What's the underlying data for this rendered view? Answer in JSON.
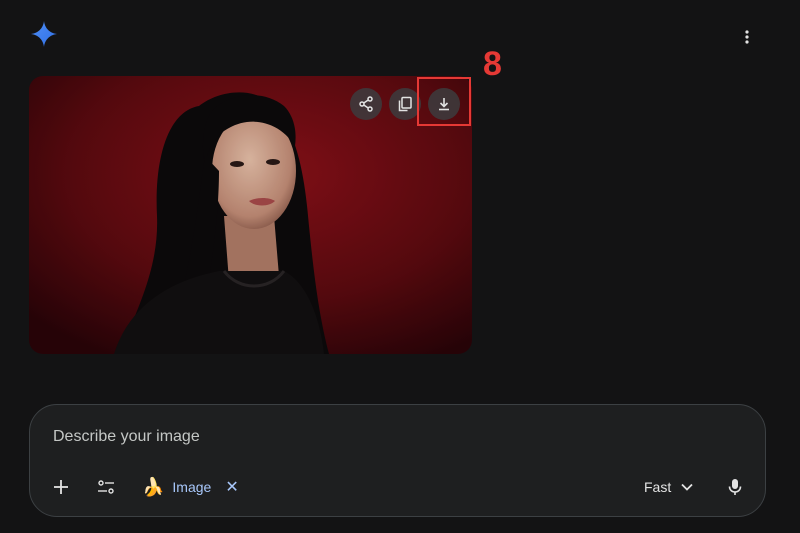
{
  "header": {
    "logo_icon": "gemini-sparkle-icon",
    "menu_icon": "more-vert-icon"
  },
  "image_result": {
    "actions": [
      {
        "name": "share",
        "icon": "share-icon"
      },
      {
        "name": "copy",
        "icon": "copy-icon"
      },
      {
        "name": "download",
        "icon": "download-icon"
      }
    ],
    "watermark_icon": "sparkle-watermark-icon"
  },
  "annotation": {
    "step_number": "8",
    "color": "#e53935"
  },
  "prompt": {
    "placeholder": "Describe your image",
    "add_icon": "plus-icon",
    "tools_icon": "tune-icon",
    "chip_emoji": "🍌",
    "chip_label": "Image",
    "chip_close": "✕",
    "mode_label": "Fast",
    "mode_icon": "chevron-down-icon",
    "mic_icon": "mic-icon"
  },
  "colors": {
    "background": "#131314",
    "accent": "#a8c7fa",
    "logo": "#4285f4"
  }
}
